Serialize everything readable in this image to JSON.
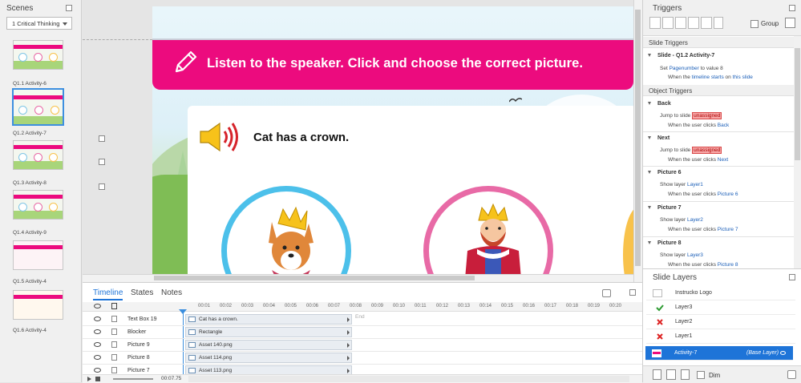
{
  "scenes_panel": {
    "title": "Scenes",
    "scene_select": "1 Critical Thinking",
    "slides": [
      {
        "label": "Q1.1 Activity-6",
        "selected": false
      },
      {
        "label": "Q1.2 Activity-7",
        "selected": true
      },
      {
        "label": "Q1.3 Activity-8",
        "selected": false
      },
      {
        "label": "Q1.4 Activity-9",
        "selected": false
      },
      {
        "label": "Q1.5 Activity-4",
        "selected": false
      },
      {
        "label": "Q1.6 Activity-4",
        "selected": false
      }
    ]
  },
  "slide": {
    "instruction": "Listen to the speaker. Click and choose the correct picture.",
    "prompt": "Cat has a crown.",
    "banner_color": "#ec0b7e",
    "circle_colors": [
      "#4cc0ea",
      "#e86aa6",
      "#f8c24b"
    ],
    "icons": [
      "pencil-icon",
      "speaker-icon",
      "corgi-with-crown",
      "king-character"
    ]
  },
  "triggers_panel": {
    "title": "Triggers",
    "group_label": "Group",
    "slide_triggers_header": "Slide Triggers",
    "slide_trigger": {
      "name": "Slide - Q1.2 Activity-7",
      "line1": {
        "text": "Set ",
        "var": "Pagenumber",
        "rest": " to value 8"
      },
      "line2": {
        "pre": "When the ",
        "obj": "timeline starts",
        "mid": " on ",
        "target": "this slide"
      }
    },
    "object_triggers_header": "Object Triggers",
    "object_triggers": [
      {
        "name": "Back",
        "action": "Jump to slide ",
        "target": "unassigned",
        "target_type": "unassigned",
        "when": "When the user clicks ",
        "object": "Back"
      },
      {
        "name": "Next",
        "action": "Jump to slide ",
        "target": "unassigned",
        "target_type": "unassigned",
        "when": "When the user clicks ",
        "object": "Next"
      },
      {
        "name": "Picture 6",
        "action": "Show layer ",
        "target": "Layer1",
        "target_type": "link",
        "when": "When the user clicks ",
        "object": "Picture 6"
      },
      {
        "name": "Picture 7",
        "action": "Show layer ",
        "target": "Layer2",
        "target_type": "link",
        "when": "When the user clicks ",
        "object": "Picture 7"
      },
      {
        "name": "Picture 8",
        "action": "Show layer ",
        "target": "Layer3",
        "target_type": "link",
        "when": "When the user clicks ",
        "object": "Picture 8"
      }
    ]
  },
  "slide_layers": {
    "title": "Slide Layers",
    "layers": [
      {
        "name": "Instrucko Logo",
        "state": "none"
      },
      {
        "name": "Layer3",
        "state": "check"
      },
      {
        "name": "Layer2",
        "state": "x"
      },
      {
        "name": "Layer1",
        "state": "x"
      },
      {
        "name": "Activity-7",
        "state": "base",
        "tag": "(Base Layer)"
      }
    ],
    "dim_label": "Dim"
  },
  "timeline": {
    "tabs": [
      "Timeline",
      "States",
      "Notes"
    ],
    "ticks": [
      "00:01",
      "00:02",
      "00:03",
      "00:04",
      "00:05",
      "00:06",
      "00:07",
      "00:08",
      "00:09",
      "00:10",
      "00:11",
      "00:12",
      "00:13",
      "00:14",
      "00:15",
      "00:16",
      "00:17",
      "00:18",
      "00:19",
      "00:20"
    ],
    "end_label": "End",
    "rows": [
      {
        "name": "Text Box 19",
        "bar": "Cat has a crown."
      },
      {
        "name": "Blocker",
        "bar": "Rectangle"
      },
      {
        "name": "Picture 9",
        "bar": "Asset 140.png"
      },
      {
        "name": "Picture 8",
        "bar": "Asset 114.png"
      },
      {
        "name": "Picture 7",
        "bar": "Asset 113.png"
      }
    ],
    "current_time": "00:07.75"
  }
}
